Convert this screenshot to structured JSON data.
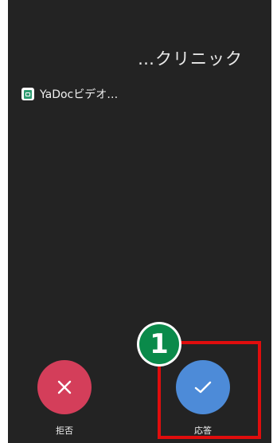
{
  "caller": {
    "name": "…クリニック"
  },
  "app": {
    "icon": "app-document-icon",
    "label": "YaDocビデオ…"
  },
  "decline": {
    "label": "拒否",
    "icon": "close-icon",
    "color": "#d43e5a"
  },
  "accept": {
    "label": "応答",
    "icon": "check-icon",
    "color": "#4d8bd8"
  },
  "annotation": {
    "step": "1",
    "highlight_color": "#e00d0d",
    "badge_color": "#0a8a4a"
  }
}
